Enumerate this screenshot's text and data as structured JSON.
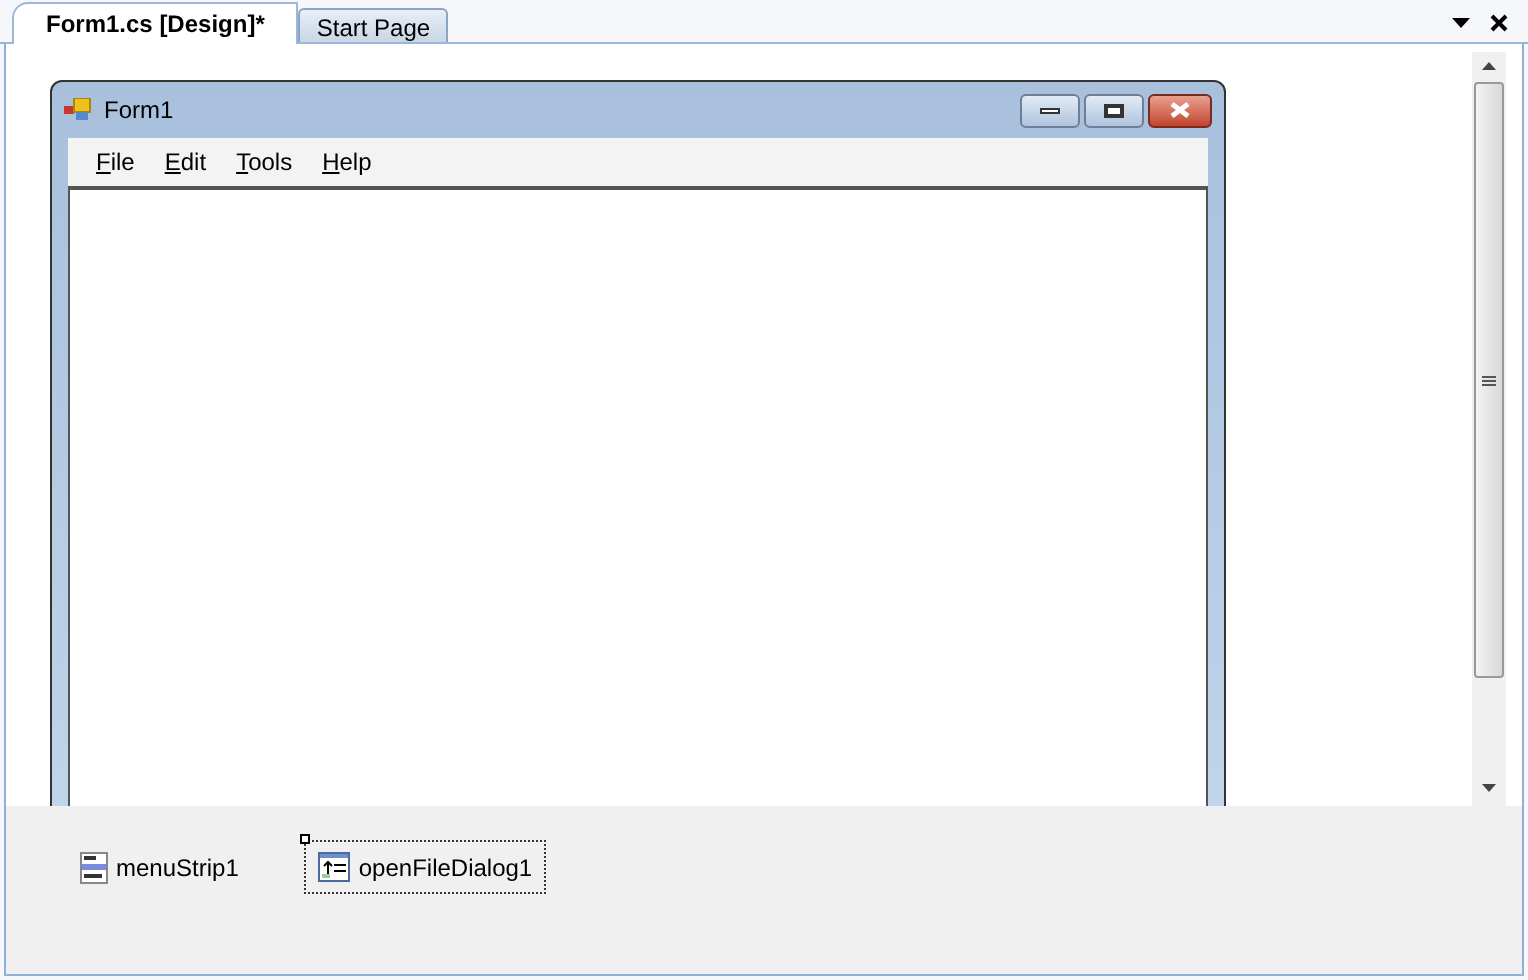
{
  "tabs": [
    {
      "label": "Form1.cs [Design]*",
      "selected": true
    },
    {
      "label": "Start Page",
      "selected": false
    }
  ],
  "form": {
    "title": "Form1",
    "menu": [
      {
        "mnemonic": "F",
        "rest": "ile"
      },
      {
        "mnemonic": "E",
        "rest": "dit"
      },
      {
        "mnemonic": "T",
        "rest": "ools"
      },
      {
        "mnemonic": "H",
        "rest": "elp"
      }
    ]
  },
  "tray": [
    {
      "kind": "menu",
      "label": "menuStrip1",
      "selected": false
    },
    {
      "kind": "dialog",
      "label": "openFileDialog1",
      "selected": true
    }
  ]
}
